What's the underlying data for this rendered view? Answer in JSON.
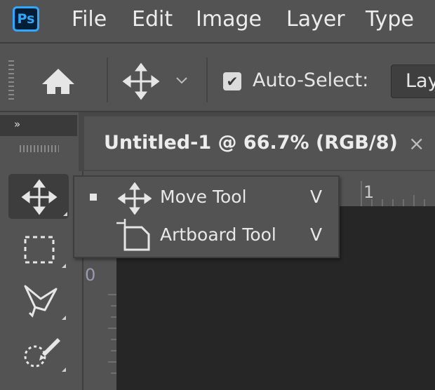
{
  "app": {
    "logo_text": "Ps",
    "accent": "#31a8ff"
  },
  "menu": [
    "File",
    "Edit",
    "Image",
    "Layer",
    "Type"
  ],
  "options_bar": {
    "home_icon": "home-icon",
    "move_icon": "move-icon",
    "auto_select_checked": true,
    "auto_select_label": "Auto-Select:",
    "auto_select_value": "Layer"
  },
  "tools_panel": {
    "collapse_glyph": "»",
    "tools": [
      "move-tool",
      "marquee-tool",
      "lasso-tool",
      "quick-selection-tool"
    ]
  },
  "document": {
    "tab_title": "Untitled-1 @ 66.7% (RGB/8)",
    "close_glyph": "×",
    "ruler_top_label": "1",
    "ruler_left_label": "0"
  },
  "flyout": {
    "items": [
      {
        "label": "Move Tool",
        "shortcut": "V",
        "selected": true
      },
      {
        "label": "Artboard Tool",
        "shortcut": "V",
        "selected": false
      }
    ]
  }
}
